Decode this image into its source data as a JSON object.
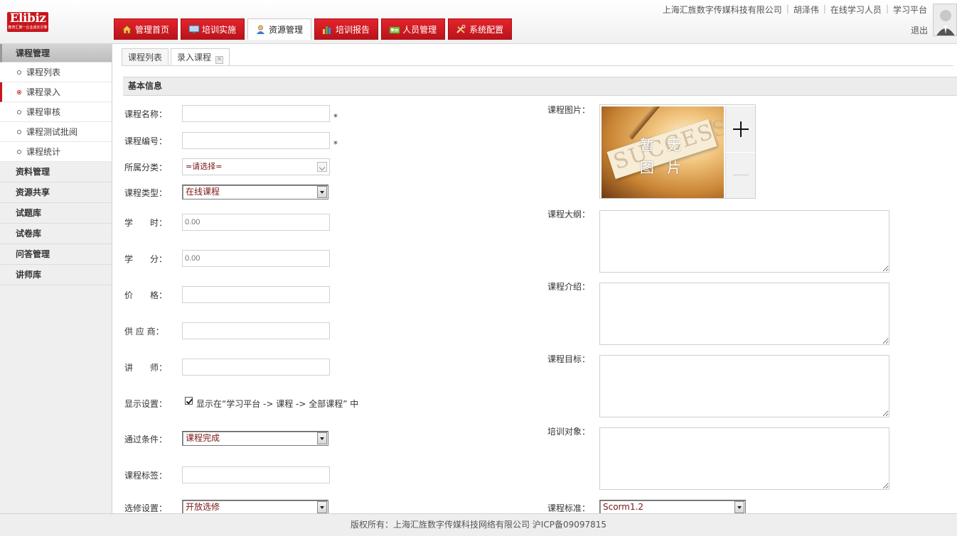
{
  "brand": {
    "logo": "Elibiz",
    "logo_sub": "教育汇聚一企业成长引擎"
  },
  "userbar": {
    "company": "上海汇旌数字传媒科技有限公司",
    "user": "胡泽伟",
    "role": "在线学习人员",
    "platform": "学习平台",
    "logout": "退出"
  },
  "nav": [
    {
      "label": "管理首页",
      "icon": "home-icon"
    },
    {
      "label": "培训实施",
      "icon": "monitor-icon"
    },
    {
      "label": "资源管理",
      "icon": "user-icon"
    },
    {
      "label": "培训报告",
      "icon": "bar-chart-icon"
    },
    {
      "label": "人员管理",
      "icon": "people-icon"
    },
    {
      "label": "系统配置",
      "icon": "tools-icon"
    }
  ],
  "sidebar": {
    "open_group": "课程管理",
    "items": [
      "课程列表",
      "课程录入",
      "课程审核",
      "课程测试批阅",
      "课程统计"
    ],
    "groups": [
      "资料管理",
      "资源共享",
      "试题库",
      "试卷库",
      "问答管理",
      "讲师库"
    ]
  },
  "subtabs": {
    "list": "课程列表",
    "entry": "录入课程"
  },
  "section": {
    "title": "基本信息"
  },
  "form": {
    "name_label": "课程名称：",
    "code_label": "课程编号：",
    "required_mark": "*",
    "category_label": "所属分类：",
    "category_value": "=请选择=",
    "type_label": "课程类型：",
    "type_value": "在线课程",
    "hours_label": "学　　时：",
    "hours_placeholder": "0.00",
    "credit_label": "学　　分：",
    "credit_placeholder": "0.00",
    "price_label": "价　　格：",
    "supplier_label": "供 应 商：",
    "teacher_label": "讲　　师：",
    "display_label": "显示设置：",
    "display_text": "显示在“学习平台 -> 课程 -> 全部课程” 中",
    "pass_label": "通过条件：",
    "pass_value": "课程完成",
    "tag_label": "课程标签：",
    "elective_label": "选修设置：",
    "elective_value": "开放选修",
    "image_label": "课程图片：",
    "image_caption_1": "暂 无",
    "image_caption_2": "图 片",
    "image_bg_text": "SUCCESS",
    "outline_label": "课程大纲：",
    "intro_label": "课程介绍：",
    "goal_label": "课程目标：",
    "audience_label": "培训对象：",
    "standard_label": "课程标准：",
    "standard_value": "Scorm1.2"
  },
  "footer": {
    "text": "版权所有：上海汇旌数字传媒科技网络有限公司 沪ICP备09097815"
  },
  "colors": {
    "accent": "#c8161d",
    "nav_active_bg": "#ffffff",
    "sidebar_bg": "#efefef"
  }
}
